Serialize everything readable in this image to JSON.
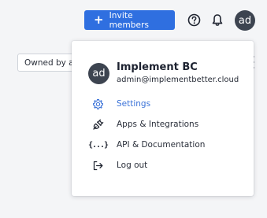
{
  "header": {
    "invite_button": {
      "icon": "plus-icon",
      "label": "Invite members",
      "color": "#2f6fe0"
    },
    "help_icon": "question-circle-icon",
    "notifications_icon": "bell-icon",
    "avatar_initials": "ad"
  },
  "filters": {
    "owned_by_label": "Owned by ar"
  },
  "user_menu": {
    "avatar_initials": "ad",
    "name": "Implement BC",
    "email": "admin@implementbetter.cloud",
    "items": [
      {
        "label": "Settings",
        "icon": "gear-icon",
        "active": true,
        "color": "#3a72d8"
      },
      {
        "label": "Apps & Integrations",
        "icon": "plug-icon",
        "active": false
      },
      {
        "label": "API & Documentation",
        "icon": "code-braces-icon",
        "active": false
      },
      {
        "label": "Log out",
        "icon": "logout-icon",
        "active": false
      }
    ]
  }
}
